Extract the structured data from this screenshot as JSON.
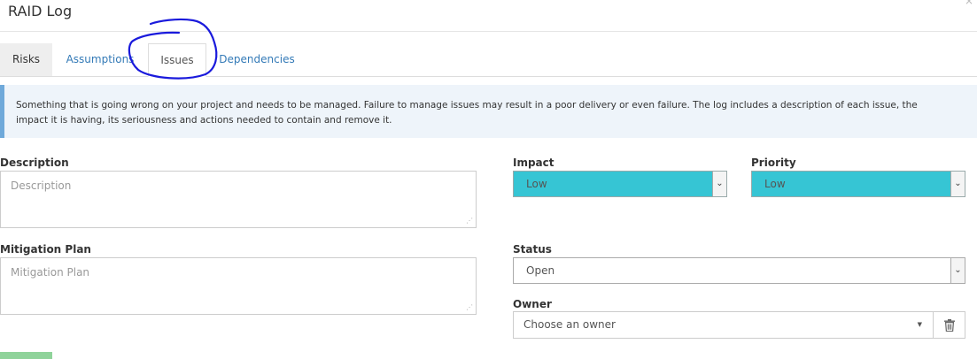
{
  "window": {
    "title": "RAID Log",
    "close_glyph": "×"
  },
  "tabs": [
    {
      "label": "Risks",
      "active": false
    },
    {
      "label": "Assumptions",
      "active": false
    },
    {
      "label": "Issues",
      "active": true
    },
    {
      "label": "Dependencies",
      "active": false
    }
  ],
  "info_text": "Something that is going wrong on your project and needs to be managed. Failure to manage issues may result in a poor delivery or even failure. The log includes a description of each issue, the impact it is having, its seriousness and actions needed to contain and remove it.",
  "form": {
    "description": {
      "label": "Description",
      "placeholder": "Description"
    },
    "mitigation": {
      "label": "Mitigation Plan",
      "placeholder": "Mitigation Plan"
    },
    "impact": {
      "label": "Impact",
      "value": "Low"
    },
    "priority": {
      "label": "Priority",
      "value": "Low"
    },
    "status": {
      "label": "Status",
      "value": "Open"
    },
    "owner": {
      "label": "Owner",
      "placeholder": "Choose an owner"
    }
  },
  "colors": {
    "select_highlight": "#36c5d4",
    "annotation_ink": "#1a1adc",
    "info_border": "#6fa9da",
    "save_button": "#8fd39a"
  },
  "icons": {
    "dropdown": "chevron-down-icon",
    "delete": "trash-icon",
    "annotation": "hand-drawn-circle"
  }
}
